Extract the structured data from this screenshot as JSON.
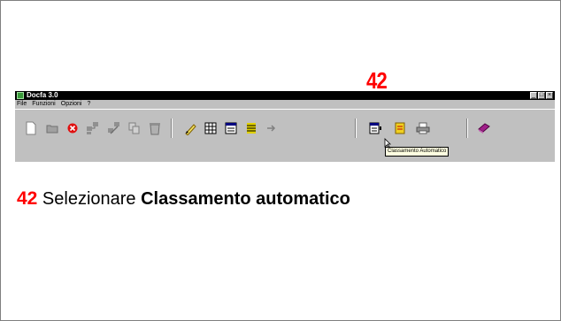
{
  "step_number": "42",
  "window": {
    "title": "Docfa 3.0",
    "menu": [
      "File",
      "Funzioni",
      "Opzioni",
      "?"
    ],
    "controls": {
      "minimize": "_",
      "maximize": "□",
      "close": "×"
    }
  },
  "toolbar": {
    "buttons": [
      {
        "name": "new-document-icon"
      },
      {
        "name": "open-folder-icon"
      },
      {
        "name": "delete-icon"
      },
      {
        "name": "copy-structure-icon"
      },
      {
        "name": "edit-structure-icon"
      },
      {
        "name": "duplicate-icon"
      },
      {
        "name": "recycle-icon"
      },
      {
        "name": "pen-icon"
      },
      {
        "name": "grid-icon"
      },
      {
        "name": "list-window-icon"
      },
      {
        "name": "stacked-lines-icon"
      },
      {
        "name": "arrow-icon"
      },
      {
        "name": "classamento-automatico-icon"
      },
      {
        "name": "note-icon"
      },
      {
        "name": "printer-icon"
      },
      {
        "name": "book-icon"
      }
    ],
    "tooltip": "Classamento Automatico"
  },
  "caption": {
    "number": "42",
    "text": " Selezionare ",
    "bold": "Classamento automatico"
  },
  "colors": {
    "accent": "#ff0000",
    "toolbar": "#c0c0c0",
    "titlebar": "#000000"
  }
}
